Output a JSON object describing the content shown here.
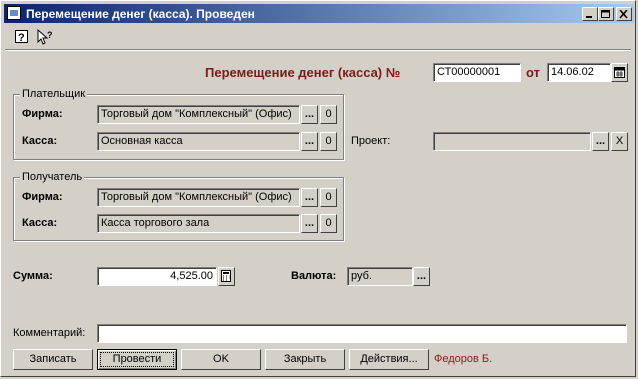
{
  "window": {
    "title": "Перемещение денег (касса). Проведен"
  },
  "toolbar": {
    "help_icon": "help-icon",
    "whatsthis_icon": "whats-this-icon"
  },
  "header": {
    "doc_title": "Перемещение денег (касса) №",
    "number": "СТ00000001",
    "date_label": "от",
    "date": "14.06.02"
  },
  "payer": {
    "group_label": "Плательщик",
    "firm_label": "Фирма:",
    "firm_value": "Торговый дом \"Комплексный\" (Офис)",
    "cash_label": "Касса:",
    "cash_value": "Основная касса"
  },
  "project": {
    "label": "Проект:",
    "value": ""
  },
  "receiver": {
    "group_label": "Получатель",
    "firm_label": "Фирма:",
    "firm_value": "Торговый дом \"Комплексный\" (Офис)",
    "cash_label": "Касса:",
    "cash_value": "Касса торгового зала"
  },
  "amount": {
    "label": "Сумма:",
    "value": "4,525.00"
  },
  "currency": {
    "label": "Валюта:",
    "value": "руб."
  },
  "comment": {
    "label": "Комментарий:",
    "value": ""
  },
  "buttons": {
    "save": "Записать",
    "post": "Провести",
    "ok": "OK",
    "close": "Закрыть",
    "actions": "Действия..."
  },
  "author": "Федоров Б.",
  "colors": {
    "title_gradient_start": "#0a246a",
    "doc_title": "#7a1a1a",
    "face": "#d4d0c8"
  }
}
